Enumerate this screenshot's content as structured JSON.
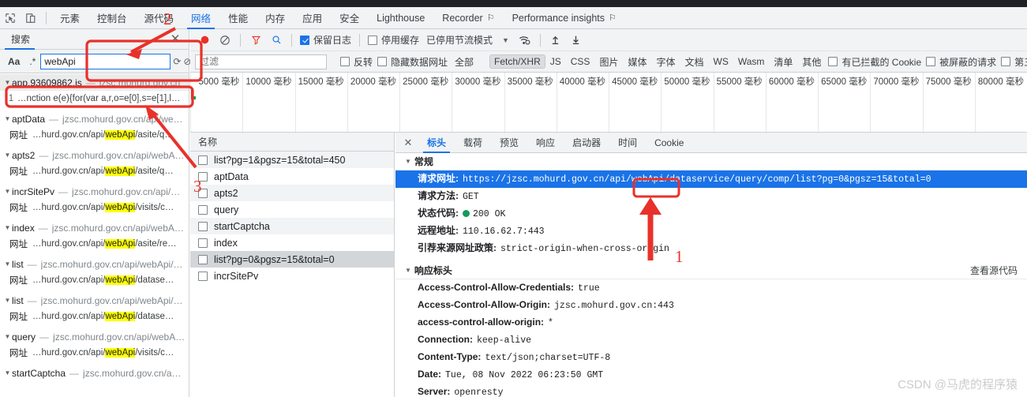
{
  "devtools": {
    "tabs": [
      {
        "label": "元素",
        "active": false
      },
      {
        "label": "控制台",
        "active": false
      },
      {
        "label": "源代码",
        "active": false
      },
      {
        "label": "网络",
        "active": true
      },
      {
        "label": "性能",
        "active": false
      },
      {
        "label": "内存",
        "active": false
      },
      {
        "label": "应用",
        "active": false
      },
      {
        "label": "安全",
        "active": false
      },
      {
        "label": "Lighthouse",
        "active": false
      },
      {
        "label": "Recorder",
        "active": false,
        "warn": "⚐"
      },
      {
        "label": "Performance insights",
        "active": false,
        "warn": "⚐"
      }
    ]
  },
  "search_panel": {
    "title": "搜索",
    "close_label": "✕",
    "match_case_label": "Aa",
    "regex_label": ".*",
    "query": "webApi",
    "placeholder": "",
    "refresh_label": "⟳",
    "clear_label": "⊘",
    "results": [
      {
        "type": "file",
        "name": "app.93609862.js",
        "url": "jzsc.mohurd.gov.cn",
        "selected": true
      },
      {
        "type": "line",
        "lineno": "1",
        "snippet": "…nction e(e){for(var a,r,o=e[0],s=e[1],l…"
      },
      {
        "type": "file",
        "name": "aptData",
        "url": "jzsc.mohurd.gov.cn/api/web…"
      },
      {
        "type": "match",
        "label": "网址",
        "pre": "…hurd.gov.cn/api/",
        "hl": "webApi",
        "post": "/asite/q…"
      },
      {
        "type": "file",
        "name": "apts2",
        "url": "jzsc.mohurd.gov.cn/api/webA…"
      },
      {
        "type": "match",
        "label": "网址",
        "pre": "…hurd.gov.cn/api/",
        "hl": "webApi",
        "post": "/asite/q…"
      },
      {
        "type": "file",
        "name": "incrSitePv",
        "url": "jzsc.mohurd.gov.cn/api/w…"
      },
      {
        "type": "match",
        "label": "网址",
        "pre": "…hurd.gov.cn/api/",
        "hl": "webApi",
        "post": "/visits/c…"
      },
      {
        "type": "file",
        "name": "index",
        "url": "jzsc.mohurd.gov.cn/api/webAp…"
      },
      {
        "type": "match",
        "label": "网址",
        "pre": "…hurd.gov.cn/api/",
        "hl": "webApi",
        "post": "/asite/re…"
      },
      {
        "type": "file",
        "name": "list",
        "url": "jzsc.mohurd.gov.cn/api/webApi/d…"
      },
      {
        "type": "match",
        "label": "网址",
        "pre": "…hurd.gov.cn/api/",
        "hl": "webApi",
        "post": "/datase…"
      },
      {
        "type": "file",
        "name": "list",
        "url": "jzsc.mohurd.gov.cn/api/webApi/d…"
      },
      {
        "type": "match",
        "label": "网址",
        "pre": "…hurd.gov.cn/api/",
        "hl": "webApi",
        "post": "/datase…"
      },
      {
        "type": "file",
        "name": "query",
        "url": "jzsc.mohurd.gov.cn/api/webA…"
      },
      {
        "type": "match",
        "label": "网址",
        "pre": "…hurd.gov.cn/api/",
        "hl": "webApi",
        "post": "/visits/c…"
      },
      {
        "type": "file",
        "name": "startCaptcha",
        "url": "jzsc.mohurd.gov.cn/api…"
      }
    ]
  },
  "network_toolbar": {
    "record_label": "●",
    "clear_label": "⊘",
    "filter_label": "filter-icon",
    "search_label": "search-icon",
    "preserve_log": {
      "label": "保留日志",
      "checked": true
    },
    "disable_cache": {
      "label": "停用缓存",
      "checked": false
    },
    "throttling": "已停用节流模式",
    "caret": "▼",
    "wifi_label": "wifi-settings-icon",
    "import_label": "↑",
    "export_label": "↓"
  },
  "filter_bar": {
    "placeholder": "过滤",
    "value": "",
    "invert": {
      "label": "反转",
      "checked": false
    },
    "hide_data_urls": {
      "label": "隐藏数据网址",
      "checked": false
    },
    "types": [
      {
        "label": "全部",
        "active": false
      },
      {
        "label": "Fetch/XHR",
        "active": true
      },
      {
        "label": "JS",
        "active": false
      },
      {
        "label": "CSS",
        "active": false
      },
      {
        "label": "图片",
        "active": false
      },
      {
        "label": "媒体",
        "active": false
      },
      {
        "label": "字体",
        "active": false
      },
      {
        "label": "文档",
        "active": false
      },
      {
        "label": "WS",
        "active": false
      },
      {
        "label": "Wasm",
        "active": false
      },
      {
        "label": "清单",
        "active": false
      },
      {
        "label": "其他",
        "active": false
      }
    ],
    "blocked_cookies": {
      "label": "有已拦截的 Cookie",
      "checked": false
    },
    "blocked_requests": {
      "label": "被屏蔽的请求",
      "checked": false
    },
    "third_party": {
      "label": "第三方",
      "checked": false
    }
  },
  "timeline": {
    "unit": "毫秒",
    "ticks": [
      "5000",
      "10000",
      "15000",
      "20000",
      "25000",
      "30000",
      "35000",
      "40000",
      "45000",
      "50000",
      "55000",
      "60000",
      "65000",
      "70000",
      "75000",
      "80000"
    ]
  },
  "request_list": {
    "column_header": "名称",
    "rows": [
      {
        "name": "list?pg=1&pgsz=15&total=450",
        "selected": false
      },
      {
        "name": "aptData",
        "selected": false
      },
      {
        "name": "apts2",
        "selected": false
      },
      {
        "name": "query",
        "selected": false
      },
      {
        "name": "startCaptcha",
        "selected": false
      },
      {
        "name": "index",
        "selected": false
      },
      {
        "name": "list?pg=0&pgsz=15&total=0",
        "selected": true
      },
      {
        "name": "incrSitePv",
        "selected": false
      }
    ]
  },
  "detail_panel": {
    "close_label": "✕",
    "tabs": [
      {
        "label": "标头",
        "active": true
      },
      {
        "label": "载荷",
        "active": false
      },
      {
        "label": "预览",
        "active": false
      },
      {
        "label": "响应",
        "active": false
      },
      {
        "label": "启动器",
        "active": false
      },
      {
        "label": "时间",
        "active": false
      },
      {
        "label": "Cookie",
        "active": false
      }
    ],
    "general": {
      "title": "常规",
      "rows": [
        {
          "key": "请求网址:",
          "value": "https://jzsc.mohurd.gov.cn/api/webApi/dataservice/query/comp/list?pg=0&pgsz=15&total=0",
          "highlighted": true
        },
        {
          "key": "请求方法:",
          "value": "GET"
        },
        {
          "key": "状态代码:",
          "value": "200 OK",
          "status_dot": true
        },
        {
          "key": "远程地址:",
          "value": "110.16.62.7:443"
        },
        {
          "key": "引荐来源网址政策:",
          "value": "strict-origin-when-cross-origin"
        }
      ]
    },
    "response_headers": {
      "title": "响应标头",
      "source_link": "查看源代码",
      "rows": [
        {
          "key": "Access-Control-Allow-Credentials:",
          "value": "true"
        },
        {
          "key": "Access-Control-Allow-Origin:",
          "value": "jzsc.mohurd.gov.cn:443"
        },
        {
          "key": "access-control-allow-origin:",
          "value": "*"
        },
        {
          "key": "Connection:",
          "value": "keep-alive"
        },
        {
          "key": "Content-Type:",
          "value": "text/json;charset=UTF-8"
        },
        {
          "key": "Date:",
          "value": "Tue, 08 Nov 2022 06:23:50 GMT"
        },
        {
          "key": "Server:",
          "value": "openresty"
        }
      ]
    }
  },
  "annotations": {
    "color": "#e8312a",
    "markers": [
      {
        "id": "1",
        "text": "1"
      },
      {
        "id": "2",
        "text": "2"
      },
      {
        "id": "3",
        "text": "3"
      },
      {
        "id": "1b",
        "text": "1"
      }
    ]
  },
  "watermark": "CSDN @马虎的程序猿"
}
